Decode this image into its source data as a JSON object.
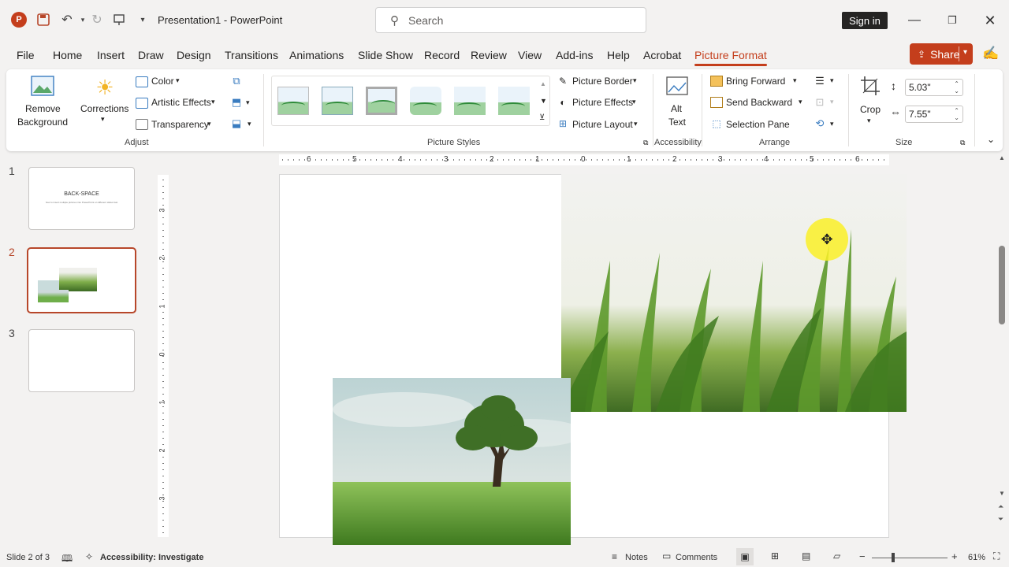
{
  "titlebar": {
    "app_initial": "P",
    "doc_title": "Presentation1  -  PowerPoint",
    "search_placeholder": "Search",
    "sign_in": "Sign in"
  },
  "menu": {
    "tabs": [
      "File",
      "Home",
      "Insert",
      "Draw",
      "Design",
      "Transitions",
      "Animations",
      "Slide Show",
      "Record",
      "Review",
      "View",
      "Add-ins",
      "Help",
      "Acrobat",
      "Picture Format"
    ],
    "active_tab": "Picture Format",
    "share": "Share"
  },
  "ribbon": {
    "adjust": {
      "remove_background_1": "Remove",
      "remove_background_2": "Background",
      "corrections": "Corrections",
      "color": "Color",
      "artistic_effects": "Artistic Effects",
      "transparency": "Transparency",
      "label": "Adjust"
    },
    "picture_styles": {
      "picture_border": "Picture Border",
      "picture_effects": "Picture Effects",
      "picture_layout": "Picture Layout",
      "label": "Picture Styles"
    },
    "accessibility": {
      "alt_1": "Alt",
      "alt_2": "Text",
      "label": "Accessibility"
    },
    "arrange": {
      "bring_forward": "Bring Forward",
      "send_backward": "Send Backward",
      "selection_pane": "Selection Pane",
      "label": "Arrange"
    },
    "size": {
      "crop": "Crop",
      "height": "5.03\"",
      "width": "7.55\"",
      "label": "Size"
    }
  },
  "slides": {
    "numbers": [
      "1",
      "2",
      "3"
    ],
    "slide1_title": "BACK-SPACE",
    "slide1_subtitle": "how to insert multiple pictures into PowerPoint on different slides fast"
  },
  "rulers": {
    "horizontal": [
      "6",
      "5",
      "4",
      "3",
      "2",
      "1",
      "0",
      "1",
      "2",
      "3",
      "4",
      "5",
      "6"
    ],
    "vertical": [
      "3",
      "2",
      "1",
      "0",
      "1",
      "2",
      "3"
    ]
  },
  "statusbar": {
    "slide_info": "Slide 2 of 3",
    "accessibility": "Accessibility: Investigate",
    "notes": "Notes",
    "comments": "Comments",
    "minus": "−",
    "plus": "+",
    "zoom": "61%"
  },
  "colors": {
    "accent": "#c43e1c",
    "slide_border_active": "#b7472a"
  }
}
